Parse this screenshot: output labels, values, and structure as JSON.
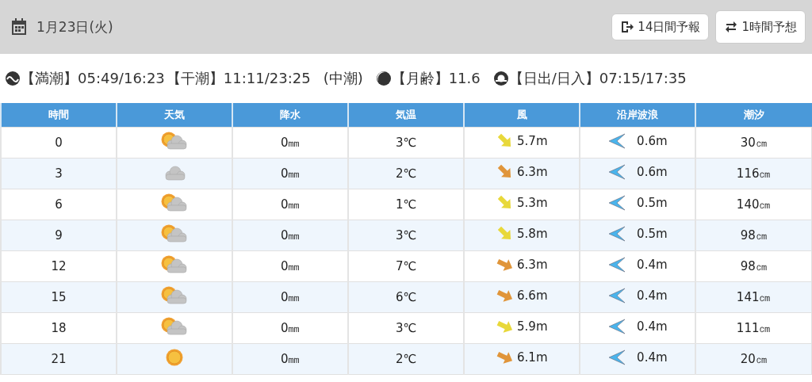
{
  "header": {
    "date": "1月23日(火)",
    "buttons": [
      {
        "label": "14日間予報",
        "kind": "exit"
      },
      {
        "label": "1時間予想",
        "kind": "swap"
      }
    ]
  },
  "info": {
    "tide_high": "【満潮】05:49/16:23",
    "tide_low": "【干潮】11:11/23:25",
    "tide_type": "(中潮)",
    "moon_age": "【月齢】11.6",
    "sun": "【日出/日入】07:15/17:35"
  },
  "table": {
    "columns": [
      "時間",
      "天気",
      "降水",
      "気温",
      "風",
      "沿岸波浪",
      "潮汐"
    ],
    "rows": [
      {
        "hour": "0",
        "weather": {
          "kind": "partly"
        },
        "rain": "0㎜",
        "temp": "3℃",
        "wind": {
          "kind": "steep",
          "color": "#e8d83a",
          "speed": "5.7m"
        },
        "wave": "0.6m",
        "tide": "30㎝"
      },
      {
        "hour": "3",
        "weather": {
          "kind": "cloudy"
        },
        "rain": "0㎜",
        "temp": "2℃",
        "wind": {
          "kind": "steep",
          "color": "#e0953a",
          "speed": "6.3m"
        },
        "wave": "0.6m",
        "tide": "116㎝"
      },
      {
        "hour": "6",
        "weather": {
          "kind": "partly"
        },
        "rain": "0㎜",
        "temp": "1℃",
        "wind": {
          "kind": "steep",
          "color": "#e8d83a",
          "speed": "5.3m"
        },
        "wave": "0.5m",
        "tide": "140㎝"
      },
      {
        "hour": "9",
        "weather": {
          "kind": "partly"
        },
        "rain": "0㎜",
        "temp": "3℃",
        "wind": {
          "kind": "steep",
          "color": "#e8d83a",
          "speed": "5.8m"
        },
        "wave": "0.5m",
        "tide": "98㎝"
      },
      {
        "hour": "12",
        "weather": {
          "kind": "partly"
        },
        "rain": "0㎜",
        "temp": "7℃",
        "wind": {
          "kind": "flat",
          "color": "#e0953a",
          "speed": "6.3m"
        },
        "wave": "0.4m",
        "tide": "98㎝"
      },
      {
        "hour": "15",
        "weather": {
          "kind": "partly"
        },
        "rain": "0㎜",
        "temp": "6℃",
        "wind": {
          "kind": "flat",
          "color": "#e0953a",
          "speed": "6.6m"
        },
        "wave": "0.4m",
        "tide": "141㎝"
      },
      {
        "hour": "18",
        "weather": {
          "kind": "partly"
        },
        "rain": "0㎜",
        "temp": "3℃",
        "wind": {
          "kind": "flat",
          "color": "#e8d83a",
          "speed": "5.9m"
        },
        "wave": "0.4m",
        "tide": "111㎝"
      },
      {
        "hour": "21",
        "weather": {
          "kind": "sunny"
        },
        "rain": "0㎜",
        "temp": "2℃",
        "wind": {
          "kind": "flat",
          "color": "#e0953a",
          "speed": "6.1m"
        },
        "wave": "0.4m",
        "tide": "20㎝"
      }
    ]
  }
}
